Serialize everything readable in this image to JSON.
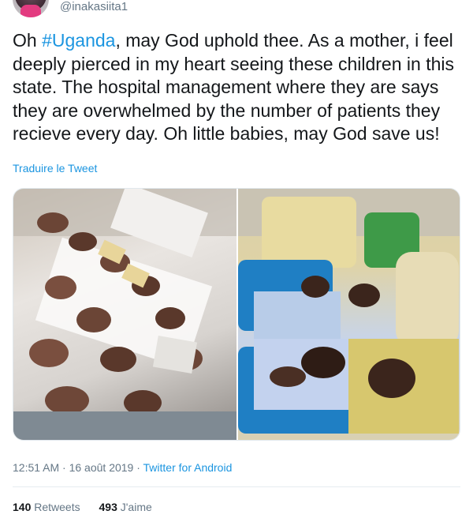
{
  "author": {
    "handle": "@inakasiita1"
  },
  "tweet": {
    "text_before": "Oh ",
    "hashtag": "#Uganda",
    "text_after": ", may God uphold thee. As a mother, i feel deeply pierced in my heart seeing these children in this state. The hospital management where they are says they are overwhelmed by the number of patients they recieve every day. Oh little babies, may God save us!"
  },
  "translate_link": "Traduire le Tweet",
  "meta": {
    "time_date": "12:51 AM · 16 août 2019 · ",
    "source": "Twitter for Android"
  },
  "stats": {
    "retweets_count": "140",
    "retweets_label": "Retweets",
    "likes_count": "493",
    "likes_label": "J'aime"
  },
  "colors": {
    "link": "#1b95e0",
    "secondary_text": "#657786",
    "divider": "#e6ecf0"
  }
}
